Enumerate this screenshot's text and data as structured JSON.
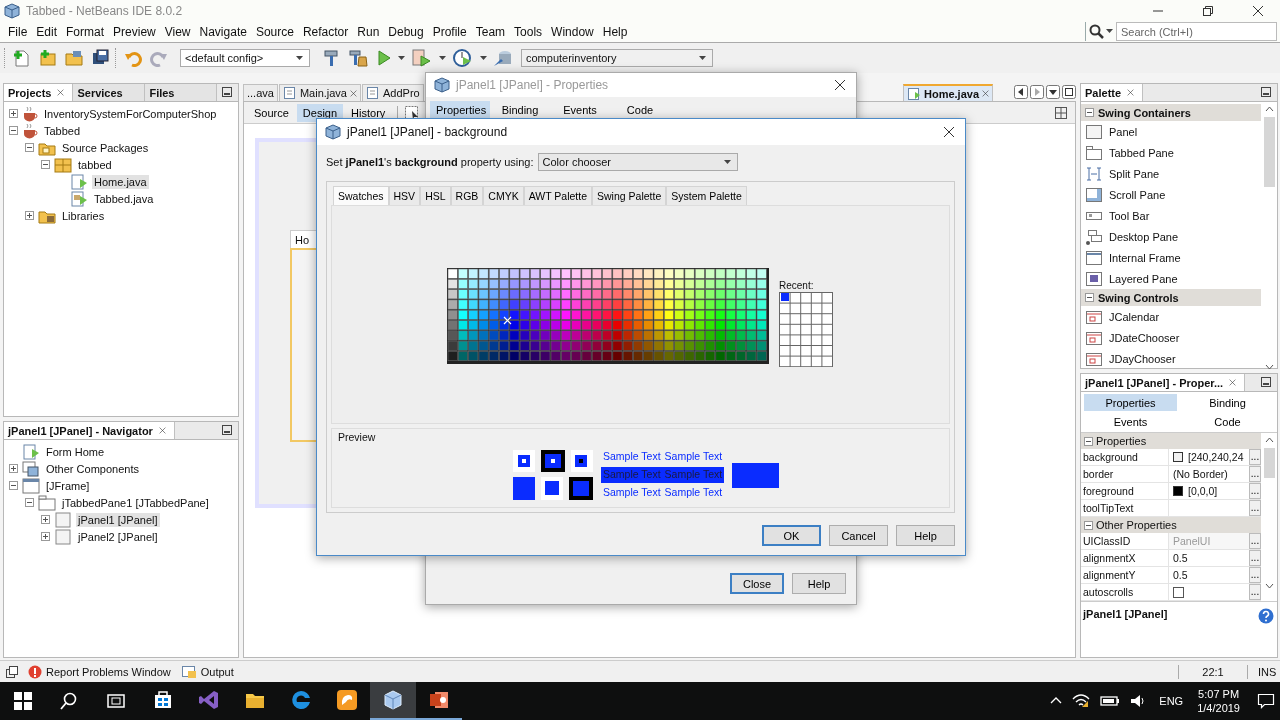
{
  "window": {
    "title": "Tabbed - NetBeans IDE 8.0.2"
  },
  "search": {
    "placeholder": "Search (Ctrl+I)"
  },
  "menu": [
    "File",
    "Edit",
    "Format",
    "Preview",
    "View",
    "Navigate",
    "Source",
    "Refactor",
    "Run",
    "Debug",
    "Profile",
    "Team",
    "Tools",
    "Window",
    "Help"
  ],
  "toolbar": {
    "config": "<default config>",
    "project": "computerinventory"
  },
  "projects": {
    "tabs": [
      {
        "label": "Projects",
        "selected": true
      },
      {
        "label": "Services",
        "selected": false
      },
      {
        "label": "Files",
        "selected": false
      }
    ],
    "tree": [
      {
        "label": "InventorySystemForComputerShop",
        "kind": "project",
        "expanded": false,
        "selected": false
      },
      {
        "label": "Tabbed",
        "kind": "project",
        "expanded": true,
        "selected": false,
        "children": [
          {
            "label": "Source Packages",
            "kind": "sources",
            "expanded": true,
            "selected": false,
            "children": [
              {
                "label": "tabbed",
                "kind": "package",
                "expanded": true,
                "selected": false,
                "children": [
                  {
                    "label": "Home.java",
                    "kind": "form",
                    "selected": true
                  },
                  {
                    "label": "Tabbed.java",
                    "kind": "class",
                    "selected": false
                  }
                ]
              }
            ]
          },
          {
            "label": "Libraries",
            "kind": "library",
            "expanded": false,
            "selected": false
          }
        ]
      }
    ]
  },
  "navigator": {
    "title": "jPanel1 [JPanel] - Navigator",
    "tree": [
      {
        "label": "Form Home",
        "kind": "form",
        "selected": false
      },
      {
        "label": "Other Components",
        "kind": "components",
        "expanded": false,
        "selected": false
      },
      {
        "label": "[JFrame]",
        "kind": "frame",
        "expanded": true,
        "selected": false,
        "children": [
          {
            "label": "jTabbedPane1 [JTabbedPane]",
            "kind": "tabbed",
            "expanded": true,
            "selected": false,
            "children": [
              {
                "label": "jPanel1 [JPanel]",
                "kind": "panel",
                "expanded": false,
                "selected": true
              },
              {
                "label": "jPanel2 [JPanel]",
                "kind": "panel",
                "expanded": false,
                "selected": false
              }
            ]
          }
        ]
      }
    ]
  },
  "editor": {
    "tabs": [
      {
        "label": "...ava",
        "kind": "partial",
        "closable": false,
        "selected": false
      },
      {
        "label": "Main.java",
        "kind": "file",
        "closable": true,
        "selected": false
      },
      {
        "label": "AddPro",
        "kind": "file",
        "closable": false,
        "selected": false
      },
      {
        "label": "Home.java",
        "kind": "file",
        "closable": true,
        "selected": true
      }
    ],
    "views": [
      {
        "label": "Source",
        "selected": false
      },
      {
        "label": "Design",
        "selected": true
      },
      {
        "label": "History",
        "selected": false
      }
    ],
    "form_tab": "Ho"
  },
  "palette": {
    "title": "Palette",
    "sections": [
      {
        "title": "Swing Containers",
        "expanded": true,
        "items": [
          {
            "label": "Panel",
            "kind": "panel"
          },
          {
            "label": "Tabbed Pane",
            "kind": "tabbed"
          },
          {
            "label": "Split Pane",
            "kind": "split"
          },
          {
            "label": "Scroll Pane",
            "kind": "scroll"
          },
          {
            "label": "Tool Bar",
            "kind": "toolbar"
          },
          {
            "label": "Desktop Pane",
            "kind": "desktop"
          },
          {
            "label": "Internal Frame",
            "kind": "frame"
          },
          {
            "label": "Layered Pane",
            "kind": "layered"
          }
        ]
      },
      {
        "title": "Swing Controls",
        "expanded": true,
        "items": [
          {
            "label": "JCalendar",
            "kind": "calendar"
          },
          {
            "label": "JDateChooser",
            "kind": "calendar"
          },
          {
            "label": "JDayChooser",
            "kind": "calendar"
          }
        ]
      }
    ]
  },
  "properties": {
    "title": "jPanel1 [JPanel] - Proper...",
    "tabs": [
      {
        "label": "Properties",
        "selected": true
      },
      {
        "label": "Binding",
        "selected": false
      },
      {
        "label": "Events",
        "selected": false
      },
      {
        "label": "Code",
        "selected": false
      }
    ],
    "sections": [
      {
        "title": "Properties",
        "expanded": true,
        "rows": [
          {
            "name": "background",
            "value": "[240,240,24",
            "color": "#f0f0f0",
            "disabled": false,
            "button": "..."
          },
          {
            "name": "border",
            "value": "(No Border)",
            "disabled": false,
            "button": "..."
          },
          {
            "name": "foreground",
            "value": "[0,0,0]",
            "color": "#000000",
            "disabled": false,
            "button": "..."
          },
          {
            "name": "toolTipText",
            "disabled": false,
            "button": "..."
          }
        ]
      },
      {
        "title": "Other Properties",
        "expanded": true,
        "rows": [
          {
            "name": "UIClassID",
            "value": "PanelUI",
            "disabled": true,
            "button": "..."
          },
          {
            "name": "alignmentX",
            "value": "0.5",
            "disabled": false,
            "button": "..."
          },
          {
            "name": "alignmentY",
            "value": "0.5",
            "disabled": false,
            "button": "..."
          },
          {
            "name": "autoscrolls",
            "kind": "checkbox",
            "checked": false,
            "disabled": false,
            "button": "..."
          }
        ]
      }
    ],
    "footer": "jPanel1 [JPanel]"
  },
  "bottom_bar": {
    "tabs": [
      "Report Problems Window",
      "Output"
    ],
    "position": "22:1",
    "mode": "INS"
  },
  "properties_dialog": {
    "title": "jPanel1 [JPanel] - Properties",
    "tabs": [
      {
        "label": "Properties",
        "selected": true
      },
      {
        "label": "Binding",
        "selected": false
      },
      {
        "label": "Events",
        "selected": false
      },
      {
        "label": "Code",
        "selected": false
      }
    ],
    "buttons": [
      {
        "label": "Close",
        "default": true
      },
      {
        "label": "Help",
        "default": false
      }
    ]
  },
  "color_dialog": {
    "title": "jPanel1 [JPanel] - background",
    "prompt": "Set **jPanel1**'s **background** property using:",
    "editor": "Color chooser",
    "tabs": [
      {
        "label": "Swatches",
        "selected": true
      },
      {
        "label": "HSV",
        "selected": false
      },
      {
        "label": "HSL",
        "selected": false
      },
      {
        "label": "RGB",
        "selected": false
      },
      {
        "label": "CMYK",
        "selected": false
      },
      {
        "label": "AWT Palette",
        "selected": false
      },
      {
        "label": "Swing Palette",
        "selected": false
      },
      {
        "label": "System Palette",
        "selected": false
      }
    ],
    "recent_label": "Recent:",
    "recent": [
      {
        "color": "#0a2cff"
      }
    ],
    "preview_label": "Preview",
    "color": "#0a2cff",
    "sample_texts": [
      "Sample Text",
      "Sample Text",
      "Sample Text",
      "Sample Text",
      "Sample Text",
      "Sample Text"
    ],
    "buttons": [
      {
        "label": "OK",
        "default": true
      },
      {
        "label": "Cancel",
        "default": false
      },
      {
        "label": "Help",
        "default": false
      }
    ]
  },
  "taskbar": {
    "apps": [
      {
        "kind": "store",
        "selected": false,
        "running": false
      },
      {
        "kind": "studio",
        "selected": false,
        "running": false
      },
      {
        "kind": "folder",
        "selected": false,
        "running": false
      },
      {
        "kind": "browser",
        "selected": false,
        "running": false
      },
      {
        "kind": "squirrel",
        "selected": false,
        "running": false
      },
      {
        "kind": "cube",
        "selected": true,
        "running": true
      },
      {
        "kind": "slides",
        "selected": false,
        "running": true
      }
    ],
    "language": "ENG",
    "time": "5:07 PM",
    "date": "1/4/2019"
  }
}
